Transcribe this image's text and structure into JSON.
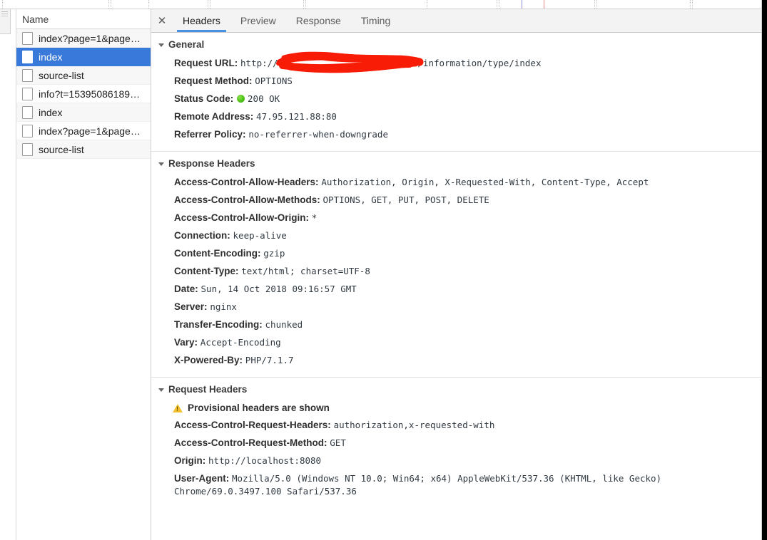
{
  "panel": {
    "request_list_header": "Name",
    "requests": [
      {
        "label": "index?page=1&page…",
        "selected": false
      },
      {
        "label": "index",
        "selected": true
      },
      {
        "label": "source-list",
        "selected": false
      },
      {
        "label": "info?t=15395086189…",
        "selected": false
      },
      {
        "label": "index",
        "selected": false
      },
      {
        "label": "index?page=1&page…",
        "selected": false
      },
      {
        "label": "source-list",
        "selected": false
      }
    ],
    "close_icon": "✕",
    "tabs": [
      {
        "label": "Headers",
        "active": true
      },
      {
        "label": "Preview",
        "active": false
      },
      {
        "label": "Response",
        "active": false
      },
      {
        "label": "Timing",
        "active": false
      }
    ]
  },
  "general": {
    "title": "General",
    "request_url_name": "Request URL:",
    "request_url_prefix": "http://",
    "request_url_redacted_hint": "redacted-host",
    "request_url_suffix": "/information/type/index",
    "request_method_name": "Request Method:",
    "request_method_value": "OPTIONS",
    "status_code_name": "Status Code:",
    "status_code_value": "200  OK",
    "remote_address_name": "Remote Address:",
    "remote_address_value": "47.95.121.88:80",
    "referrer_policy_name": "Referrer Policy:",
    "referrer_policy_value": "no-referrer-when-downgrade"
  },
  "response_headers": {
    "title": "Response Headers",
    "items": [
      {
        "name": "Access-Control-Allow-Headers:",
        "value": "Authorization, Origin, X-Requested-With, Content-Type, Accept"
      },
      {
        "name": "Access-Control-Allow-Methods:",
        "value": "OPTIONS, GET, PUT, POST, DELETE"
      },
      {
        "name": "Access-Control-Allow-Origin:",
        "value": "*"
      },
      {
        "name": "Connection:",
        "value": "keep-alive"
      },
      {
        "name": "Content-Encoding:",
        "value": "gzip"
      },
      {
        "name": "Content-Type:",
        "value": "text/html; charset=UTF-8"
      },
      {
        "name": "Date:",
        "value": "Sun, 14 Oct 2018 09:16:57 GMT"
      },
      {
        "name": "Server:",
        "value": "nginx"
      },
      {
        "name": "Transfer-Encoding:",
        "value": "chunked"
      },
      {
        "name": "Vary:",
        "value": "Accept-Encoding"
      },
      {
        "name": "X-Powered-By:",
        "value": "PHP/7.1.7"
      }
    ]
  },
  "request_headers": {
    "title": "Request Headers",
    "provisional_notice": "Provisional headers are shown",
    "items": [
      {
        "name": "Access-Control-Request-Headers:",
        "value": "authorization,x-requested-with"
      },
      {
        "name": "Access-Control-Request-Method:",
        "value": "GET"
      },
      {
        "name": "Origin:",
        "value": "http://localhost:8080"
      },
      {
        "name": "User-Agent:",
        "value": "Mozilla/5.0 (Windows NT 10.0; Win64; x64) AppleWebKit/537.36 (KHTML, like Gecko) Chrome/69.0.3497.100 Safari/537.36"
      }
    ]
  },
  "colors": {
    "selection_blue": "#3879d9",
    "tab_underline": "#4a90e2",
    "status_green": "#4cc417",
    "warning_yellow": "#f2c12e",
    "redaction_red": "#f81c06"
  }
}
